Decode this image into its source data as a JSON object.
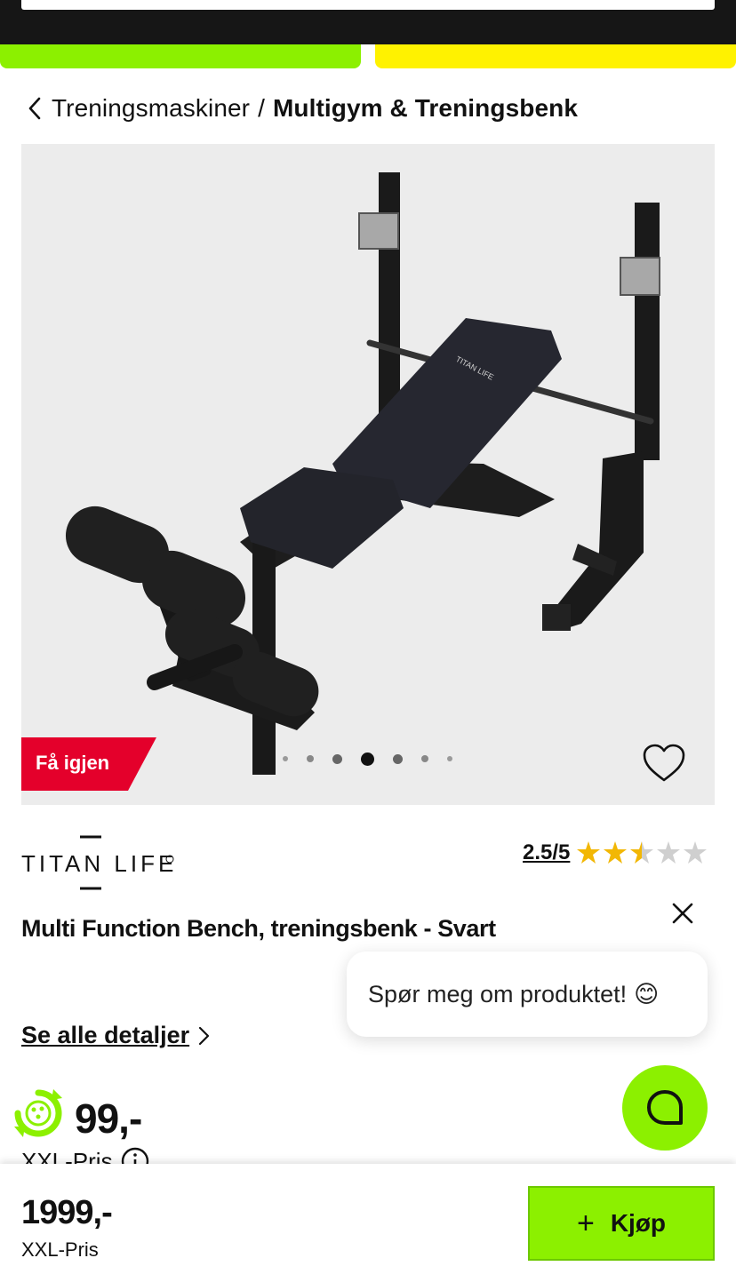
{
  "breadcrumb": {
    "parent": "Treningsmaskiner",
    "separator": "/",
    "current": "Multigym & Treningsbenk"
  },
  "gallery": {
    "image_alt": "Multi Function Bench, treningsbenk - Svart",
    "print_on_seat": "TITAN LIFE",
    "badge": "Få igjen",
    "dot_count": 7,
    "active_dot": 4
  },
  "brand": {
    "logo_text": "TITAN LIFE"
  },
  "rating": {
    "score": "2.5/5",
    "stars_out_of_5": 2.5
  },
  "product": {
    "title": "Multi Function Bench, treningsbenk - Svart"
  },
  "chat": {
    "prompt": "Spør meg om produktet!",
    "emoji": "😊"
  },
  "details": {
    "link_label": "Se alle detaljer"
  },
  "price": {
    "partial": "99,-",
    "label": "XXL-Pris"
  },
  "bottom": {
    "price": "1999,-",
    "label": "XXL-Pris",
    "buy_label": "Kjøp"
  },
  "colors": {
    "accent_green": "#8cf000",
    "accent_yellow": "#fff200",
    "badge_red": "#e4002b",
    "star_gold": "#f2b705"
  }
}
